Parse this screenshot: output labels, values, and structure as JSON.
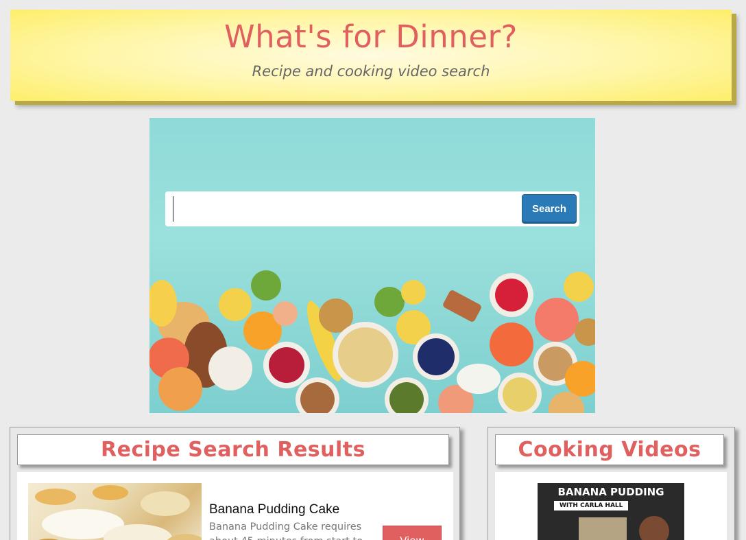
{
  "header": {
    "title": "What's for Dinner?",
    "subtitle": "Recipe and cooking video search"
  },
  "search": {
    "value": "",
    "placeholder": "",
    "button_label": "Search"
  },
  "recipes": {
    "heading": "Recipe Search Results",
    "items": [
      {
        "name": "Banana Pudding Cake",
        "description": "Banana Pudding Cake requires about 45 minutes from start to",
        "button_label": "View"
      }
    ]
  },
  "videos": {
    "heading": "Cooking Videos",
    "items": [
      {
        "thumb_title": "BANANA PUDDING",
        "thumb_subtitle": "WITH CARLA HALL"
      }
    ]
  },
  "colors": {
    "accent": "#e06060",
    "button": "#2a7ab8",
    "banner": "#fff6a8",
    "background": "#ebebeb"
  }
}
